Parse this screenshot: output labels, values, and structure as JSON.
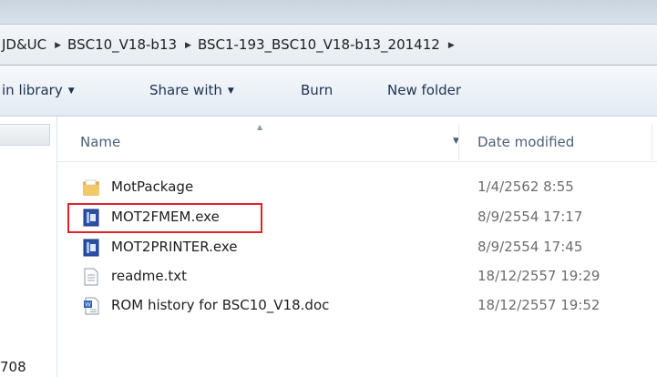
{
  "address": {
    "crumbs": [
      "JD&UC",
      "BSC10_V18-b13",
      "BSC1-193_BSC10_V18-b13_201412"
    ]
  },
  "toolbar": {
    "include_library": "in library",
    "share_with": "Share with",
    "burn": "Burn",
    "new_folder": "New folder"
  },
  "columns": {
    "name": "Name",
    "date_modified": "Date modified"
  },
  "navpane": {
    "item": "708"
  },
  "files": [
    {
      "name": "MotPackage",
      "date": "1/4/2562 8:55",
      "icon": "folder-icon"
    },
    {
      "name": "MOT2FMEM.exe",
      "date": "8/9/2554 17:17",
      "icon": "exe-icon"
    },
    {
      "name": "MOT2PRINTER.exe",
      "date": "8/9/2554 17:45",
      "icon": "exe-icon"
    },
    {
      "name": "readme.txt",
      "date": "18/12/2557 19:29",
      "icon": "text-file-icon"
    },
    {
      "name": "ROM history for BSC10_V18.doc",
      "date": "18/12/2557 19:52",
      "icon": "word-doc-icon"
    }
  ],
  "colors": {
    "highlight_box": "#e0232b",
    "folder": "#e8b64a",
    "exe": "#2a4fa8"
  }
}
